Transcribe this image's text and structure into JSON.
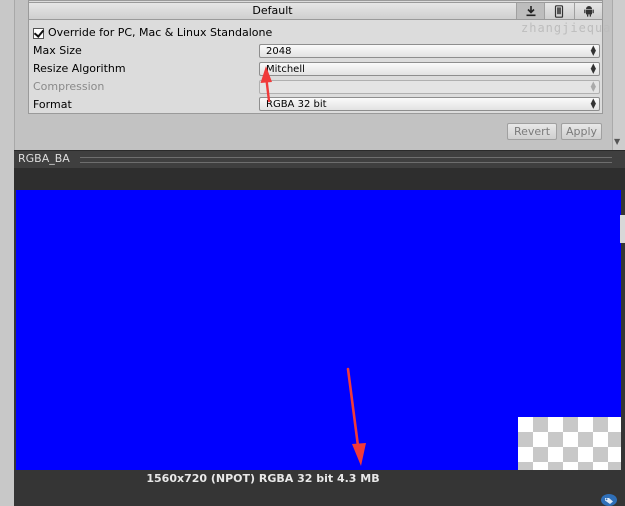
{
  "header": {
    "tab_label": "Default",
    "platform_tabs": [
      "download-icon",
      "mobile-icon",
      "android-icon"
    ]
  },
  "override": {
    "checked": true,
    "label": "Override for PC, Mac & Linux Standalone"
  },
  "watermark": "zhangjiequan",
  "settings": {
    "max_size": {
      "label": "Max Size",
      "value": "2048"
    },
    "resize_algorithm": {
      "label": "Resize Algorithm",
      "value": "Mitchell"
    },
    "compression": {
      "label": "Compression",
      "value": ""
    },
    "format": {
      "label": "Format",
      "value": "RGBA 32 bit"
    }
  },
  "buttons": {
    "revert": "Revert",
    "apply": "Apply"
  },
  "preview": {
    "asset_name": "RGBA_BA",
    "texture_color": "#0000ff",
    "info": "1560x720 (NPOT)  RGBA 32 bit   4.3 MB"
  },
  "annotations": {
    "arrow_color": "#f03a3a"
  },
  "colors": {
    "panel_bg": "#dcdcdc",
    "preview_bg": "#353535",
    "header_bg": "#3f3f3f"
  }
}
